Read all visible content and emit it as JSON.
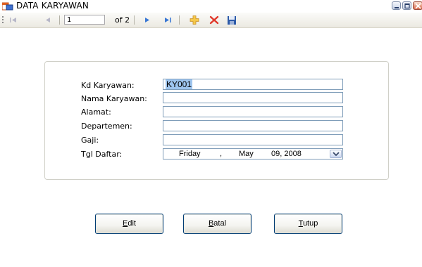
{
  "window": {
    "title": "DATA KARYAWAN"
  },
  "navigator": {
    "position": "1",
    "count_text": "of 2"
  },
  "form": {
    "fields": [
      {
        "label": "Kd Karyawan:",
        "value": "KY001"
      },
      {
        "label": "Nama Karyawan:",
        "value": ""
      },
      {
        "label": "Alamat:",
        "value": ""
      },
      {
        "label": "Departemen:",
        "value": ""
      },
      {
        "label": "Gaji:",
        "value": ""
      }
    ],
    "date": {
      "label": "Tgl Daftar:",
      "weekday": "Friday",
      "sep": ",",
      "month": "May",
      "day_year": "09, 2008"
    }
  },
  "buttons": {
    "edit": {
      "mnemonic": "E",
      "rest": "dit"
    },
    "batal": {
      "mnemonic": "B",
      "rest": "atal"
    },
    "tutup": {
      "mnemonic": "T",
      "rest": "utup"
    }
  },
  "colors": {
    "selection": "#9ec5ef",
    "textbox_border": "#7f9db9",
    "button_border": "#003c74"
  }
}
